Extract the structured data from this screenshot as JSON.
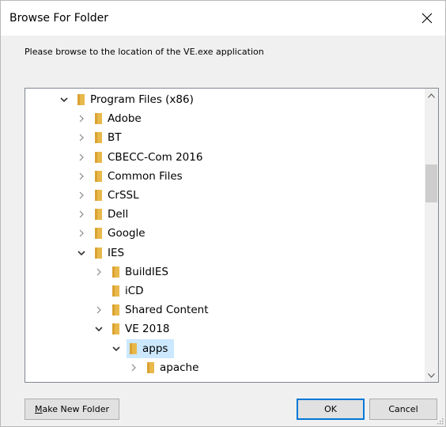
{
  "window": {
    "title": "Browse For Folder",
    "instruction": "Please browse to the location of the VE.exe application"
  },
  "tree": [
    {
      "label": "Program Files (x86)",
      "level": 0,
      "expanded": true,
      "hasChildren": true
    },
    {
      "label": "Adobe",
      "level": 1,
      "expanded": false,
      "hasChildren": true
    },
    {
      "label": "BT",
      "level": 1,
      "expanded": false,
      "hasChildren": true
    },
    {
      "label": "CBECC-Com 2016",
      "level": 1,
      "expanded": false,
      "hasChildren": true
    },
    {
      "label": "Common Files",
      "level": 1,
      "expanded": false,
      "hasChildren": true
    },
    {
      "label": "CrSSL",
      "level": 1,
      "expanded": false,
      "hasChildren": true
    },
    {
      "label": "Dell",
      "level": 1,
      "expanded": false,
      "hasChildren": true
    },
    {
      "label": "Google",
      "level": 1,
      "expanded": false,
      "hasChildren": true
    },
    {
      "label": "IES",
      "level": 1,
      "expanded": true,
      "hasChildren": true
    },
    {
      "label": "BuildIES",
      "level": 2,
      "expanded": false,
      "hasChildren": true
    },
    {
      "label": "iCD",
      "level": 2,
      "expanded": false,
      "hasChildren": false
    },
    {
      "label": "Shared Content",
      "level": 2,
      "expanded": false,
      "hasChildren": true
    },
    {
      "label": "VE 2018",
      "level": 2,
      "expanded": true,
      "hasChildren": true
    },
    {
      "label": "apps",
      "level": 3,
      "expanded": true,
      "hasChildren": true,
      "selected": true
    },
    {
      "label": "apache",
      "level": 4,
      "expanded": false,
      "hasChildren": true
    }
  ],
  "buttons": {
    "make_new_folder": "Make New Folder",
    "make_new_folder_mnemonic": "M",
    "make_new_folder_rest": "ake New Folder",
    "ok": "OK",
    "cancel": "Cancel"
  },
  "colors": {
    "folder": "#e8b84a",
    "folder_dark": "#d9a233",
    "selection": "#cce8ff",
    "default_border": "#0078d7"
  },
  "icons": {
    "close": "close-icon",
    "folder": "folder-icon",
    "expand": "chevron-right-icon",
    "collapse": "chevron-down-icon"
  }
}
